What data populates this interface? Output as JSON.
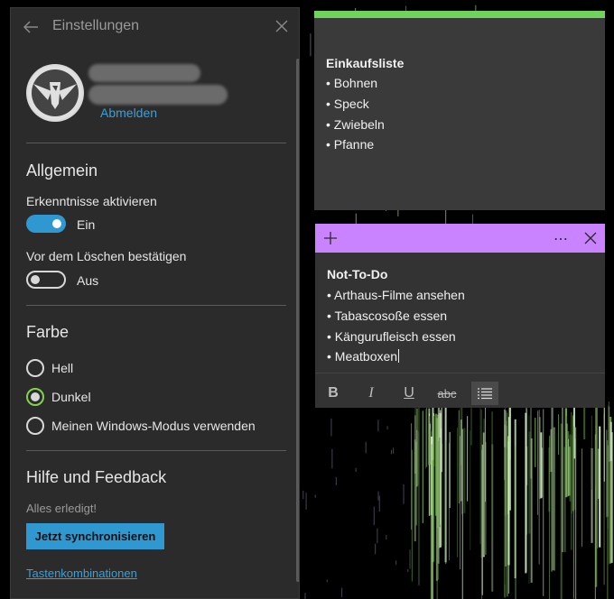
{
  "settings": {
    "title": "Einstellungen",
    "sign_out": "Abmelden",
    "general": {
      "heading": "Allgemein",
      "insights_label": "Erkenntnisse aktivieren",
      "insights_state": "Ein",
      "confirm_delete_label": "Vor dem Löschen bestätigen",
      "confirm_delete_state": "Aus"
    },
    "color": {
      "heading": "Farbe",
      "options": [
        "Hell",
        "Dunkel",
        "Meinen Windows-Modus verwenden"
      ],
      "selected": "Dunkel"
    },
    "help": {
      "heading": "Hilfe und Feedback",
      "status": "Alles erledigt!",
      "sync_button": "Jetzt synchronisieren",
      "shortcuts_link": "Tastenkombinationen"
    }
  },
  "note1": {
    "accent": "#6fd35c",
    "title": "Einkaufsliste",
    "items": [
      "• Bohnen",
      "• Speck",
      "• Zwiebeln",
      "• Pfanne"
    ]
  },
  "note2": {
    "accent": "#c983ff",
    "title": "Not-To-Do",
    "items": [
      "• Arthaus-Filme ansehen",
      "• Tabascosoße essen",
      "• Kängurufleisch essen",
      "• Meatboxen"
    ],
    "toolbar": {
      "bold": "B",
      "italic": "I",
      "underline": "U",
      "strikethrough": "abc"
    }
  },
  "colors": {
    "accent_blue": "#2f98d1",
    "link_blue": "#3aa0d8",
    "radio_selected": "#7fd44b"
  }
}
